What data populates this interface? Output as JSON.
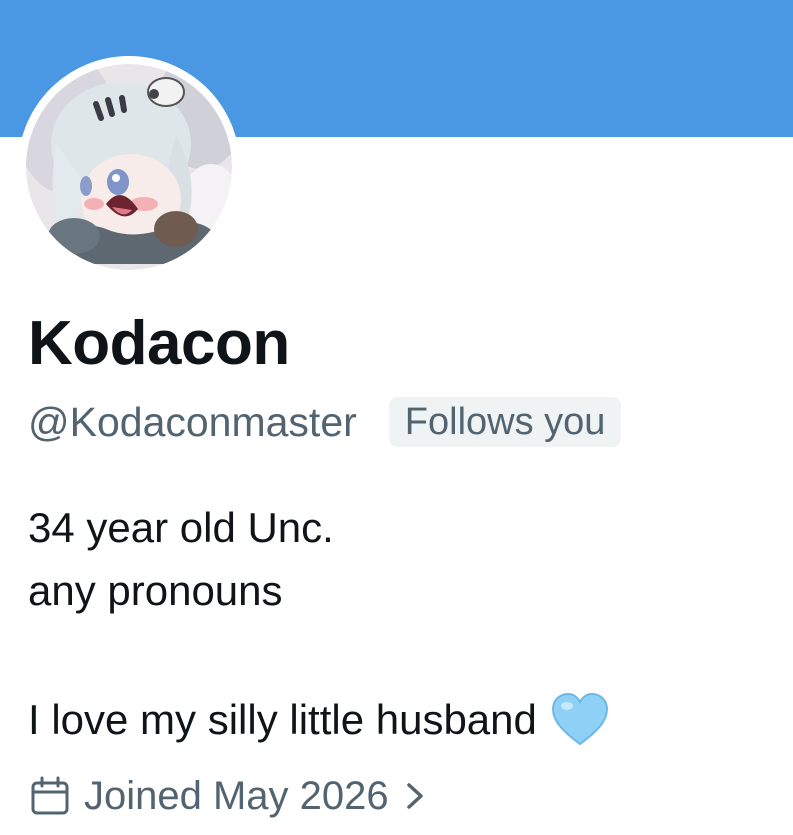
{
  "colors": {
    "banner": "#4a98e4",
    "text_primary": "#0f1419",
    "text_secondary": "#536471",
    "badge_bg": "#eff3f4",
    "heart": "#8fd0f6"
  },
  "profile": {
    "display_name": "Kodacon",
    "handle": "@Kodaconmaster",
    "follows_badge": "Follows you",
    "avatar_icon": "avatar-anime-character",
    "bio": {
      "line1": "34 year old Unc.",
      "line2": "any pronouns",
      "line3": "I love my silly little husband",
      "emoji": "light-blue-heart-icon"
    },
    "joined": {
      "icon": "calendar-icon",
      "text": "Joined May 2026",
      "chevron": "chevron-right-icon"
    }
  }
}
